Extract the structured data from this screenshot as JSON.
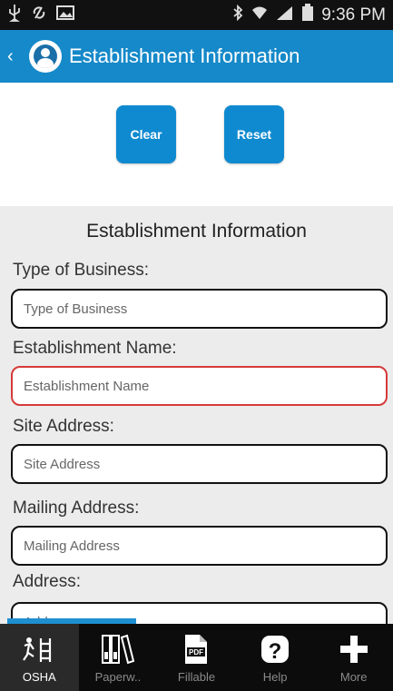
{
  "status_bar": {
    "time": "9:36 PM",
    "icons": [
      "usb-icon",
      "sync-icon",
      "image-icon",
      "bluetooth-icon",
      "wifi-icon",
      "signal-icon",
      "battery-icon"
    ]
  },
  "action_bar": {
    "title": "Establishment Information",
    "color": "#1589c9"
  },
  "buttons": {
    "clear_label": "Clear",
    "reset_label": "Reset"
  },
  "form": {
    "heading": "Establishment Information",
    "fields": [
      {
        "label": "Type of Business:",
        "placeholder": "Type of Business",
        "value": ""
      },
      {
        "label": "Establishment Name:",
        "placeholder": "Establishment Name",
        "value": "",
        "state": "error"
      },
      {
        "label": "Site Address:",
        "placeholder": "Site Address",
        "value": ""
      },
      {
        "label": "Mailing Address:",
        "placeholder": "Mailing Address",
        "value": ""
      },
      {
        "label": "Address:",
        "placeholder": "Address",
        "value": ""
      }
    ]
  },
  "tabs": [
    {
      "label": "OSHA",
      "icon": "osha-icon",
      "active": true
    },
    {
      "label": "Paperw..",
      "icon": "books-icon",
      "active": false
    },
    {
      "label": "Fillable",
      "icon": "pdf-icon",
      "active": false
    },
    {
      "label": "Help",
      "icon": "help-icon",
      "active": false
    },
    {
      "label": "More",
      "icon": "plus-icon",
      "active": false
    }
  ],
  "colors": {
    "accent": "#0f8ad0",
    "error_border": "#d63a3a",
    "form_background": "#ececec"
  }
}
